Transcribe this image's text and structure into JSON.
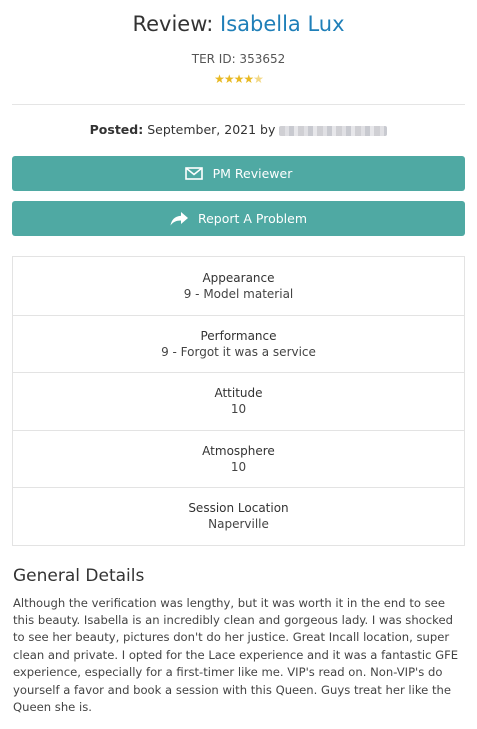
{
  "header": {
    "title_prefix": "Review:",
    "title_name": "Isabella Lux",
    "ter_id": "TER ID: 353652",
    "rating": 4.5
  },
  "posted": {
    "label": "Posted:",
    "text": "September, 2021 by"
  },
  "buttons": {
    "pm_label": "PM Reviewer",
    "report_label": "Report A Problem"
  },
  "details": [
    {
      "label": "Appearance",
      "value": "9 - Model material"
    },
    {
      "label": "Performance",
      "value": "9 - Forgot it was a service"
    },
    {
      "label": "Attitude",
      "value": "10"
    },
    {
      "label": "Atmosphere",
      "value": "10"
    },
    {
      "label": "Session Location",
      "value": "Naperville"
    }
  ],
  "general": {
    "title": "General Details",
    "body": "Although the verification was lengthy, but it was worth it in the end to see this beauty. Isabella is an incredibly clean and gorgeous lady. I was shocked to see her beauty, pictures don't do her justice. Great Incall location, super clean and private. I opted for the Lace experience and it was a fantastic GFE experience, especially for a first-timer like me. VIP's read on. Non-VIP's do yourself a favor and book a session with this Queen. Guys treat her like the Queen she is."
  },
  "colors": {
    "accent": "#4fa9a3",
    "link": "#1f7fb8",
    "star": "#e8b923"
  }
}
